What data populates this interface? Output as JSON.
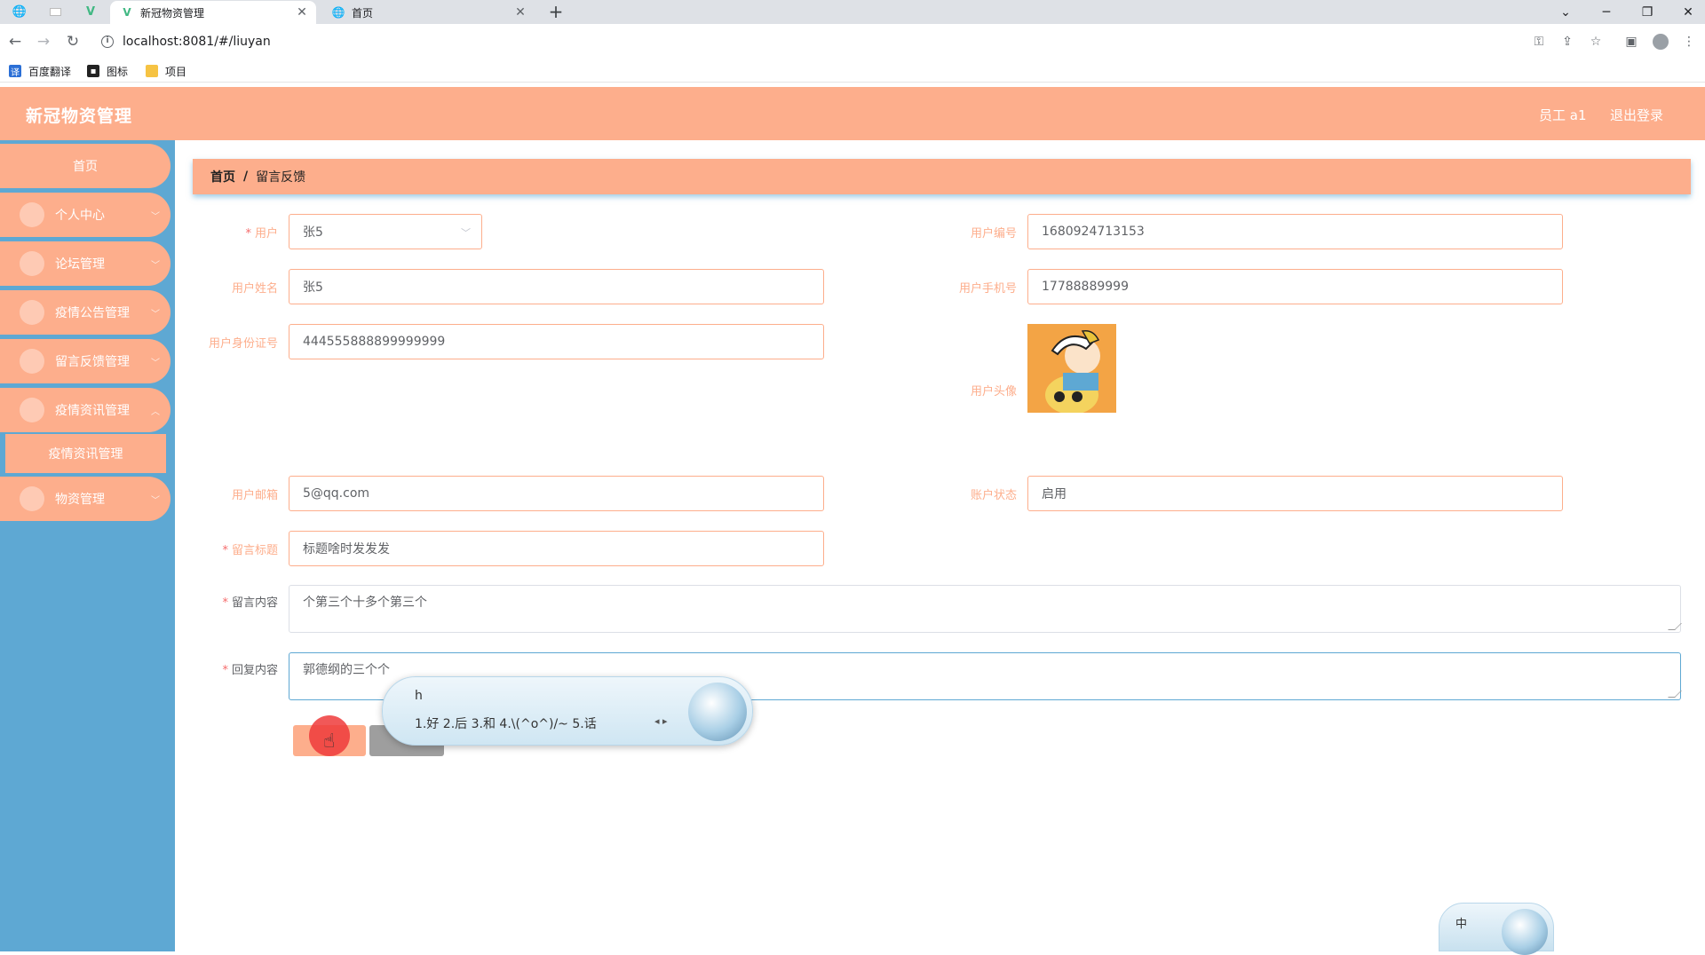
{
  "browser": {
    "tabs": [
      {
        "title": "新冠物资管理",
        "active": true
      },
      {
        "title": "首页",
        "active": false
      }
    ],
    "url": "localhost:8081/#/liuyan",
    "bookmarks": [
      {
        "label": "百度翻译",
        "icon": "translate-icon"
      },
      {
        "label": "图标",
        "icon": "image-icon"
      },
      {
        "label": "项目",
        "icon": "folder-icon"
      }
    ]
  },
  "header": {
    "title": "新冠物资管理",
    "user": "员工 a1",
    "logout": "退出登录",
    "color": "#fdae8c"
  },
  "sidebar": {
    "color": "#5ea8d3",
    "home": "首页",
    "items": [
      {
        "label": "个人中心",
        "icon": "user-icon"
      },
      {
        "label": "论坛管理",
        "icon": "briefcase-icon"
      },
      {
        "label": "疫情公告管理",
        "icon": "grid-icon"
      },
      {
        "label": "留言反馈管理",
        "icon": "grid-icon"
      },
      {
        "label": "疫情资讯管理",
        "icon": "user-icon"
      },
      {
        "label": "物资管理",
        "icon": "grid-icon"
      }
    ],
    "sub_item": "疫情资讯管理"
  },
  "breadcrumb": {
    "home": "首页",
    "sep": "/",
    "current": "留言反馈"
  },
  "form": {
    "user_label": "用户",
    "user_value": "张5",
    "user_no_label": "用户编号",
    "user_no_value": "1680924713153",
    "name_label": "用户姓名",
    "name_value": "张5",
    "phone_label": "用户手机号",
    "phone_value": "17788889999",
    "idcard_label": "用户身份证号",
    "idcard_value": "444555888899999999",
    "avatar_label": "用户头像",
    "email_label": "用户邮箱",
    "email_value": "5@qq.com",
    "status_label": "账户状态",
    "status_value": "启用",
    "title_label": "留言标题",
    "title_value": "标题啥时发发发",
    "content_label": "留言内容",
    "content_value": "个第三个十多个第三个",
    "reply_label": "回复内容",
    "reply_value": "郭德纲的三个个"
  },
  "ime": {
    "input": "h",
    "candidates": "1.好   2.后   3.和   4.\\(^o^)/~   5.话",
    "status": "中"
  }
}
